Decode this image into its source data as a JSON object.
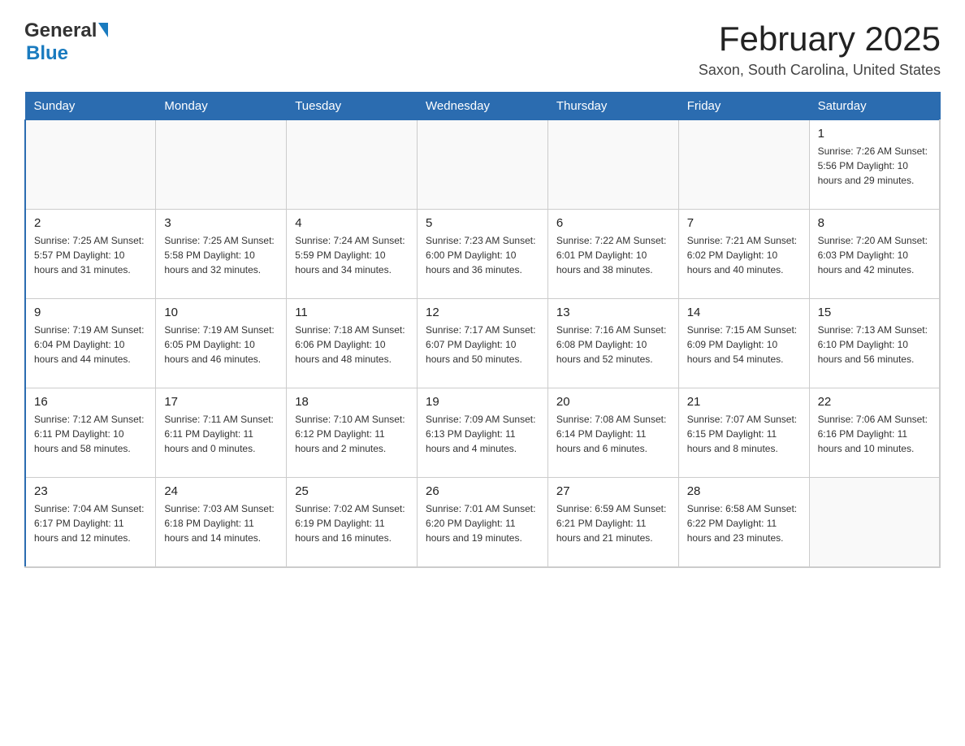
{
  "header": {
    "logo_general": "General",
    "logo_blue": "Blue",
    "title": "February 2025",
    "subtitle": "Saxon, South Carolina, United States"
  },
  "days_of_week": [
    "Sunday",
    "Monday",
    "Tuesday",
    "Wednesday",
    "Thursday",
    "Friday",
    "Saturday"
  ],
  "weeks": [
    [
      {
        "day": "",
        "info": ""
      },
      {
        "day": "",
        "info": ""
      },
      {
        "day": "",
        "info": ""
      },
      {
        "day": "",
        "info": ""
      },
      {
        "day": "",
        "info": ""
      },
      {
        "day": "",
        "info": ""
      },
      {
        "day": "1",
        "info": "Sunrise: 7:26 AM\nSunset: 5:56 PM\nDaylight: 10 hours and 29 minutes."
      }
    ],
    [
      {
        "day": "2",
        "info": "Sunrise: 7:25 AM\nSunset: 5:57 PM\nDaylight: 10 hours and 31 minutes."
      },
      {
        "day": "3",
        "info": "Sunrise: 7:25 AM\nSunset: 5:58 PM\nDaylight: 10 hours and 32 minutes."
      },
      {
        "day": "4",
        "info": "Sunrise: 7:24 AM\nSunset: 5:59 PM\nDaylight: 10 hours and 34 minutes."
      },
      {
        "day": "5",
        "info": "Sunrise: 7:23 AM\nSunset: 6:00 PM\nDaylight: 10 hours and 36 minutes."
      },
      {
        "day": "6",
        "info": "Sunrise: 7:22 AM\nSunset: 6:01 PM\nDaylight: 10 hours and 38 minutes."
      },
      {
        "day": "7",
        "info": "Sunrise: 7:21 AM\nSunset: 6:02 PM\nDaylight: 10 hours and 40 minutes."
      },
      {
        "day": "8",
        "info": "Sunrise: 7:20 AM\nSunset: 6:03 PM\nDaylight: 10 hours and 42 minutes."
      }
    ],
    [
      {
        "day": "9",
        "info": "Sunrise: 7:19 AM\nSunset: 6:04 PM\nDaylight: 10 hours and 44 minutes."
      },
      {
        "day": "10",
        "info": "Sunrise: 7:19 AM\nSunset: 6:05 PM\nDaylight: 10 hours and 46 minutes."
      },
      {
        "day": "11",
        "info": "Sunrise: 7:18 AM\nSunset: 6:06 PM\nDaylight: 10 hours and 48 minutes."
      },
      {
        "day": "12",
        "info": "Sunrise: 7:17 AM\nSunset: 6:07 PM\nDaylight: 10 hours and 50 minutes."
      },
      {
        "day": "13",
        "info": "Sunrise: 7:16 AM\nSunset: 6:08 PM\nDaylight: 10 hours and 52 minutes."
      },
      {
        "day": "14",
        "info": "Sunrise: 7:15 AM\nSunset: 6:09 PM\nDaylight: 10 hours and 54 minutes."
      },
      {
        "day": "15",
        "info": "Sunrise: 7:13 AM\nSunset: 6:10 PM\nDaylight: 10 hours and 56 minutes."
      }
    ],
    [
      {
        "day": "16",
        "info": "Sunrise: 7:12 AM\nSunset: 6:11 PM\nDaylight: 10 hours and 58 minutes."
      },
      {
        "day": "17",
        "info": "Sunrise: 7:11 AM\nSunset: 6:11 PM\nDaylight: 11 hours and 0 minutes."
      },
      {
        "day": "18",
        "info": "Sunrise: 7:10 AM\nSunset: 6:12 PM\nDaylight: 11 hours and 2 minutes."
      },
      {
        "day": "19",
        "info": "Sunrise: 7:09 AM\nSunset: 6:13 PM\nDaylight: 11 hours and 4 minutes."
      },
      {
        "day": "20",
        "info": "Sunrise: 7:08 AM\nSunset: 6:14 PM\nDaylight: 11 hours and 6 minutes."
      },
      {
        "day": "21",
        "info": "Sunrise: 7:07 AM\nSunset: 6:15 PM\nDaylight: 11 hours and 8 minutes."
      },
      {
        "day": "22",
        "info": "Sunrise: 7:06 AM\nSunset: 6:16 PM\nDaylight: 11 hours and 10 minutes."
      }
    ],
    [
      {
        "day": "23",
        "info": "Sunrise: 7:04 AM\nSunset: 6:17 PM\nDaylight: 11 hours and 12 minutes."
      },
      {
        "day": "24",
        "info": "Sunrise: 7:03 AM\nSunset: 6:18 PM\nDaylight: 11 hours and 14 minutes."
      },
      {
        "day": "25",
        "info": "Sunrise: 7:02 AM\nSunset: 6:19 PM\nDaylight: 11 hours and 16 minutes."
      },
      {
        "day": "26",
        "info": "Sunrise: 7:01 AM\nSunset: 6:20 PM\nDaylight: 11 hours and 19 minutes."
      },
      {
        "day": "27",
        "info": "Sunrise: 6:59 AM\nSunset: 6:21 PM\nDaylight: 11 hours and 21 minutes."
      },
      {
        "day": "28",
        "info": "Sunrise: 6:58 AM\nSunset: 6:22 PM\nDaylight: 11 hours and 23 minutes."
      },
      {
        "day": "",
        "info": ""
      }
    ]
  ]
}
